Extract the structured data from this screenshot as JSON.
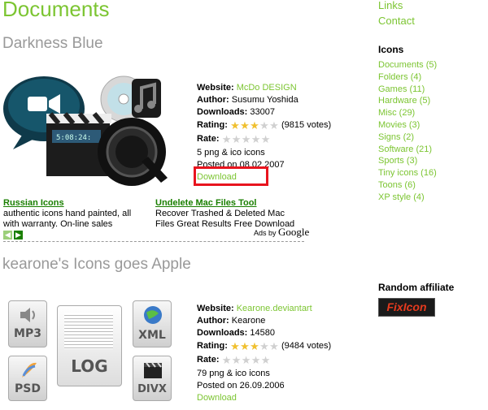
{
  "page_title": "Documents",
  "sidebar": {
    "top_links": [
      "Links",
      "Contact"
    ],
    "icons_heading": "Icons",
    "categories": [
      "Documents (5)",
      "Folders (4)",
      "Games (11)",
      "Hardware (5)",
      "Misc (29)",
      "Movies (3)",
      "Signs (2)",
      "Software (21)",
      "Sports (3)",
      "Tiny icons (16)",
      "Toons (6)",
      "XP style (4)"
    ],
    "affiliate_heading": "Random affiliate",
    "affiliate_logo_text": "FixIcon"
  },
  "entries": [
    {
      "title": "Darkness Blue",
      "website_label": "Website:",
      "website_value": "McDo DESIGN",
      "author_label": "Author:",
      "author_value": "Susumu Yoshida",
      "downloads_label": "Downloads:",
      "downloads_value": "33007",
      "rating_label": "Rating:",
      "rating_stars": 3,
      "rating_votes": "(9815 votes)",
      "rate_label": "Rate:",
      "count_text": "5 png & ico icons",
      "posted_text": "Posted on 08.02.2007",
      "download_label": "Download",
      "preview_icons": [
        "video-chat-icon",
        "cd-music-icon",
        "clapperboard-icon",
        "quicktime-icon"
      ]
    },
    {
      "title": "kearone's Icons goes Apple",
      "website_label": "Website:",
      "website_value": "Kearone.deviantart",
      "author_label": "Author:",
      "author_value": "Kearone",
      "downloads_label": "Downloads:",
      "downloads_value": "14580",
      "rating_label": "Rating:",
      "rating_stars": 3,
      "rating_votes": "(9484 votes)",
      "rate_label": "Rate:",
      "count_text": "79 png & ico icons",
      "posted_text": "Posted on 26.09.2006",
      "download_label": "Download",
      "preview_icons": {
        "mp3": "MP3",
        "log": "LOG",
        "xml": "XML",
        "psd": "PSD",
        "divx": "DIVX"
      }
    }
  ],
  "ads": [
    {
      "title": "Russian Icons",
      "text": "authentic icons hand painted, all with warranty. On-line sales"
    },
    {
      "title": "Undelete Mac Files Tool",
      "text": "Recover Trashed & Deleted Mac Files Great Results Free Download"
    }
  ],
  "ads_by_prefix": "Ads by",
  "ads_by_brand": "Google",
  "colors": {
    "accent": "#7cc532",
    "highlight": "#e8141e",
    "ad_link": "#1a7f00"
  }
}
